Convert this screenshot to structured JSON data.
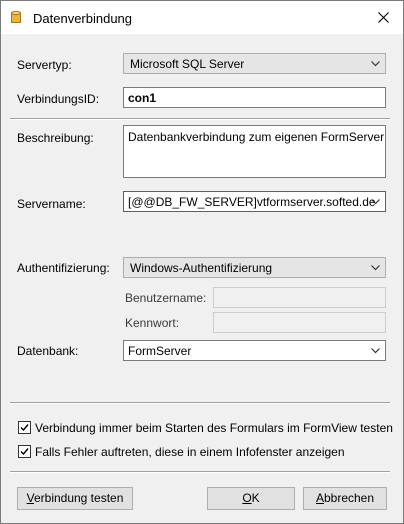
{
  "window": {
    "title": "Datenverbindung"
  },
  "form": {
    "servertyp_label": "Servertyp:",
    "servertyp_value": "Microsoft SQL Server",
    "verbindungsid_label": "VerbindungsID:",
    "verbindungsid_value": "con1",
    "beschreibung_label": "Beschreibung:",
    "beschreibung_value": "Datenbankverbindung zum eigenen FormServer",
    "servername_label": "Servername:",
    "servername_value": "[@@DB_FW_SERVER]vtformserver.softed.de",
    "auth_label": "Authentifizierung:",
    "auth_value": "Windows-Authentifizierung",
    "benutzername_label": "Benutzername:",
    "benutzername_value": "",
    "kennwort_label": "Kennwort:",
    "kennwort_value": "",
    "datenbank_label": "Datenbank:",
    "datenbank_value": "FormServer"
  },
  "options": {
    "check1_label": "Verbindung immer beim Starten des Formulars im FormView testen",
    "check1_checked": true,
    "check2_label": "Falls Fehler auftreten, diese in einem Infofenster anzeigen",
    "check2_checked": true
  },
  "buttons": {
    "test_first": "V",
    "test_rest": "erbindung testen",
    "ok_first": "O",
    "ok_rest": "K",
    "cancel_first": "A",
    "cancel_rest": "bbrechen"
  }
}
